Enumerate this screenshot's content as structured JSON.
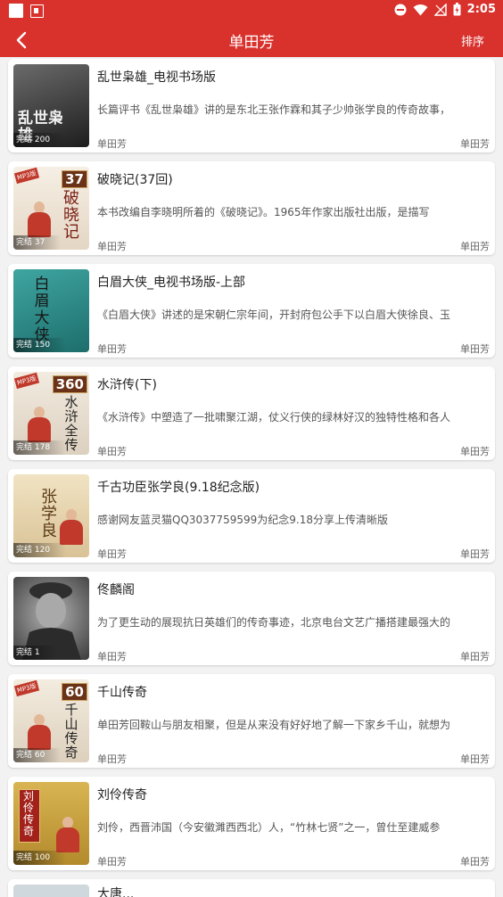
{
  "status_bar": {
    "time": "2:05"
  },
  "header": {
    "title": "单田芳",
    "sort_label": "排序"
  },
  "items": [
    {
      "title": "乱世枭雄_电视书场版",
      "desc": "长篇评书《乱世枭雄》讲的是东北王张作霖和其子少帅张学良的传奇故事，",
      "author": "单田芳",
      "author2": "单田芳",
      "badge": "完结 200",
      "cover_text": "乱世枭雄",
      "cover_bg": "#3a3a3a",
      "cover_fg": "#e6e6e6"
    },
    {
      "title": "破晓记(37回)",
      "desc": "本书改编自李晓明所着的《破晓记》。1965年作家出版社出版，是描写",
      "author": "单田芳",
      "author2": "单田芳",
      "badge": "完结 37",
      "num": "37",
      "cover_text": "破晓记",
      "cover_bg": "#f3ece2",
      "cover_fg": "#7a1f14"
    },
    {
      "title": "白眉大侠_电视书场版-上部",
      "desc": "《白眉大侠》讲述的是宋朝仁宗年间，开封府包公手下以白眉大侠徐良、玉",
      "author": "单田芳",
      "author2": "单田芳",
      "badge": "完结 150",
      "cover_text": "白眉大侠",
      "cover_bg": "#2f8c8a",
      "cover_fg": "#1a1a1a"
    },
    {
      "title": "水浒传(下)",
      "desc": "《水浒传》中塑造了一批啸聚江湖，仗义行侠的绿林好汉的独特性格和各人",
      "author": "单田芳",
      "author2": "单田芳",
      "badge": "完结 178",
      "num": "360",
      "cover_text": "水浒全传",
      "cover_bg": "#efe7dc",
      "cover_fg": "#222222"
    },
    {
      "title": "千古功臣张学良(9.18纪念版)",
      "desc": "感谢网友蓝灵猫QQ3037759599为纪念9.18分享上传清晰版",
      "author": "单田芳",
      "author2": "单田芳",
      "badge": "完结 120",
      "cover_text": "张学良",
      "cover_bg": "#e9d9b8",
      "cover_fg": "#5a3a16"
    },
    {
      "title": "佟麟阁",
      "desc": "为了更生动的展现抗日英雄们的传奇事迹，北京电台文艺广播搭建最强大的",
      "author": "单田芳",
      "author2": "单田芳",
      "badge": "完结 1",
      "cover_text": "",
      "cover_bg": "#8a8a8a",
      "cover_fg": "#ffffff"
    },
    {
      "title": "千山传奇",
      "desc": "单田芳回鞍山与朋友相聚，但是从来没有好好地了解一下家乡千山，就想为",
      "author": "单田芳",
      "author2": "单田芳",
      "badge": "完结 60",
      "num": "60",
      "cover_text": "千山传奇",
      "cover_bg": "#f0e9de",
      "cover_fg": "#222222"
    },
    {
      "title": "刘伶传奇",
      "desc": "刘伶，西晋沛国（今安徽濉西西北）人，“竹林七贤”之一，曾仕至建威参",
      "author": "单田芳",
      "author2": "单田芳",
      "badge": "完结 100",
      "cover_text": "刘伶传奇",
      "cover_bg": "#c9a646",
      "cover_fg": "#7b1010"
    }
  ],
  "partial_item": {
    "title": "大唐..."
  }
}
